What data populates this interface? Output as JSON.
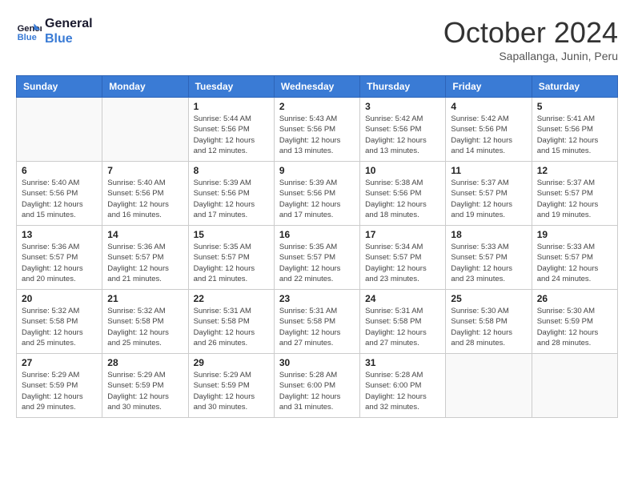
{
  "header": {
    "logo_general": "General",
    "logo_blue": "Blue",
    "title": "October 2024",
    "location": "Sapallanga, Junin, Peru"
  },
  "days_of_week": [
    "Sunday",
    "Monday",
    "Tuesday",
    "Wednesday",
    "Thursday",
    "Friday",
    "Saturday"
  ],
  "weeks": [
    [
      {
        "day": "",
        "info": ""
      },
      {
        "day": "",
        "info": ""
      },
      {
        "day": "1",
        "info": "Sunrise: 5:44 AM\nSunset: 5:56 PM\nDaylight: 12 hours\nand 12 minutes."
      },
      {
        "day": "2",
        "info": "Sunrise: 5:43 AM\nSunset: 5:56 PM\nDaylight: 12 hours\nand 13 minutes."
      },
      {
        "day": "3",
        "info": "Sunrise: 5:42 AM\nSunset: 5:56 PM\nDaylight: 12 hours\nand 13 minutes."
      },
      {
        "day": "4",
        "info": "Sunrise: 5:42 AM\nSunset: 5:56 PM\nDaylight: 12 hours\nand 14 minutes."
      },
      {
        "day": "5",
        "info": "Sunrise: 5:41 AM\nSunset: 5:56 PM\nDaylight: 12 hours\nand 15 minutes."
      }
    ],
    [
      {
        "day": "6",
        "info": "Sunrise: 5:40 AM\nSunset: 5:56 PM\nDaylight: 12 hours\nand 15 minutes."
      },
      {
        "day": "7",
        "info": "Sunrise: 5:40 AM\nSunset: 5:56 PM\nDaylight: 12 hours\nand 16 minutes."
      },
      {
        "day": "8",
        "info": "Sunrise: 5:39 AM\nSunset: 5:56 PM\nDaylight: 12 hours\nand 17 minutes."
      },
      {
        "day": "9",
        "info": "Sunrise: 5:39 AM\nSunset: 5:56 PM\nDaylight: 12 hours\nand 17 minutes."
      },
      {
        "day": "10",
        "info": "Sunrise: 5:38 AM\nSunset: 5:56 PM\nDaylight: 12 hours\nand 18 minutes."
      },
      {
        "day": "11",
        "info": "Sunrise: 5:37 AM\nSunset: 5:57 PM\nDaylight: 12 hours\nand 19 minutes."
      },
      {
        "day": "12",
        "info": "Sunrise: 5:37 AM\nSunset: 5:57 PM\nDaylight: 12 hours\nand 19 minutes."
      }
    ],
    [
      {
        "day": "13",
        "info": "Sunrise: 5:36 AM\nSunset: 5:57 PM\nDaylight: 12 hours\nand 20 minutes."
      },
      {
        "day": "14",
        "info": "Sunrise: 5:36 AM\nSunset: 5:57 PM\nDaylight: 12 hours\nand 21 minutes."
      },
      {
        "day": "15",
        "info": "Sunrise: 5:35 AM\nSunset: 5:57 PM\nDaylight: 12 hours\nand 21 minutes."
      },
      {
        "day": "16",
        "info": "Sunrise: 5:35 AM\nSunset: 5:57 PM\nDaylight: 12 hours\nand 22 minutes."
      },
      {
        "day": "17",
        "info": "Sunrise: 5:34 AM\nSunset: 5:57 PM\nDaylight: 12 hours\nand 23 minutes."
      },
      {
        "day": "18",
        "info": "Sunrise: 5:33 AM\nSunset: 5:57 PM\nDaylight: 12 hours\nand 23 minutes."
      },
      {
        "day": "19",
        "info": "Sunrise: 5:33 AM\nSunset: 5:57 PM\nDaylight: 12 hours\nand 24 minutes."
      }
    ],
    [
      {
        "day": "20",
        "info": "Sunrise: 5:32 AM\nSunset: 5:58 PM\nDaylight: 12 hours\nand 25 minutes."
      },
      {
        "day": "21",
        "info": "Sunrise: 5:32 AM\nSunset: 5:58 PM\nDaylight: 12 hours\nand 25 minutes."
      },
      {
        "day": "22",
        "info": "Sunrise: 5:31 AM\nSunset: 5:58 PM\nDaylight: 12 hours\nand 26 minutes."
      },
      {
        "day": "23",
        "info": "Sunrise: 5:31 AM\nSunset: 5:58 PM\nDaylight: 12 hours\nand 27 minutes."
      },
      {
        "day": "24",
        "info": "Sunrise: 5:31 AM\nSunset: 5:58 PM\nDaylight: 12 hours\nand 27 minutes."
      },
      {
        "day": "25",
        "info": "Sunrise: 5:30 AM\nSunset: 5:58 PM\nDaylight: 12 hours\nand 28 minutes."
      },
      {
        "day": "26",
        "info": "Sunrise: 5:30 AM\nSunset: 5:59 PM\nDaylight: 12 hours\nand 28 minutes."
      }
    ],
    [
      {
        "day": "27",
        "info": "Sunrise: 5:29 AM\nSunset: 5:59 PM\nDaylight: 12 hours\nand 29 minutes."
      },
      {
        "day": "28",
        "info": "Sunrise: 5:29 AM\nSunset: 5:59 PM\nDaylight: 12 hours\nand 30 minutes."
      },
      {
        "day": "29",
        "info": "Sunrise: 5:29 AM\nSunset: 5:59 PM\nDaylight: 12 hours\nand 30 minutes."
      },
      {
        "day": "30",
        "info": "Sunrise: 5:28 AM\nSunset: 6:00 PM\nDaylight: 12 hours\nand 31 minutes."
      },
      {
        "day": "31",
        "info": "Sunrise: 5:28 AM\nSunset: 6:00 PM\nDaylight: 12 hours\nand 32 minutes."
      },
      {
        "day": "",
        "info": ""
      },
      {
        "day": "",
        "info": ""
      }
    ]
  ]
}
